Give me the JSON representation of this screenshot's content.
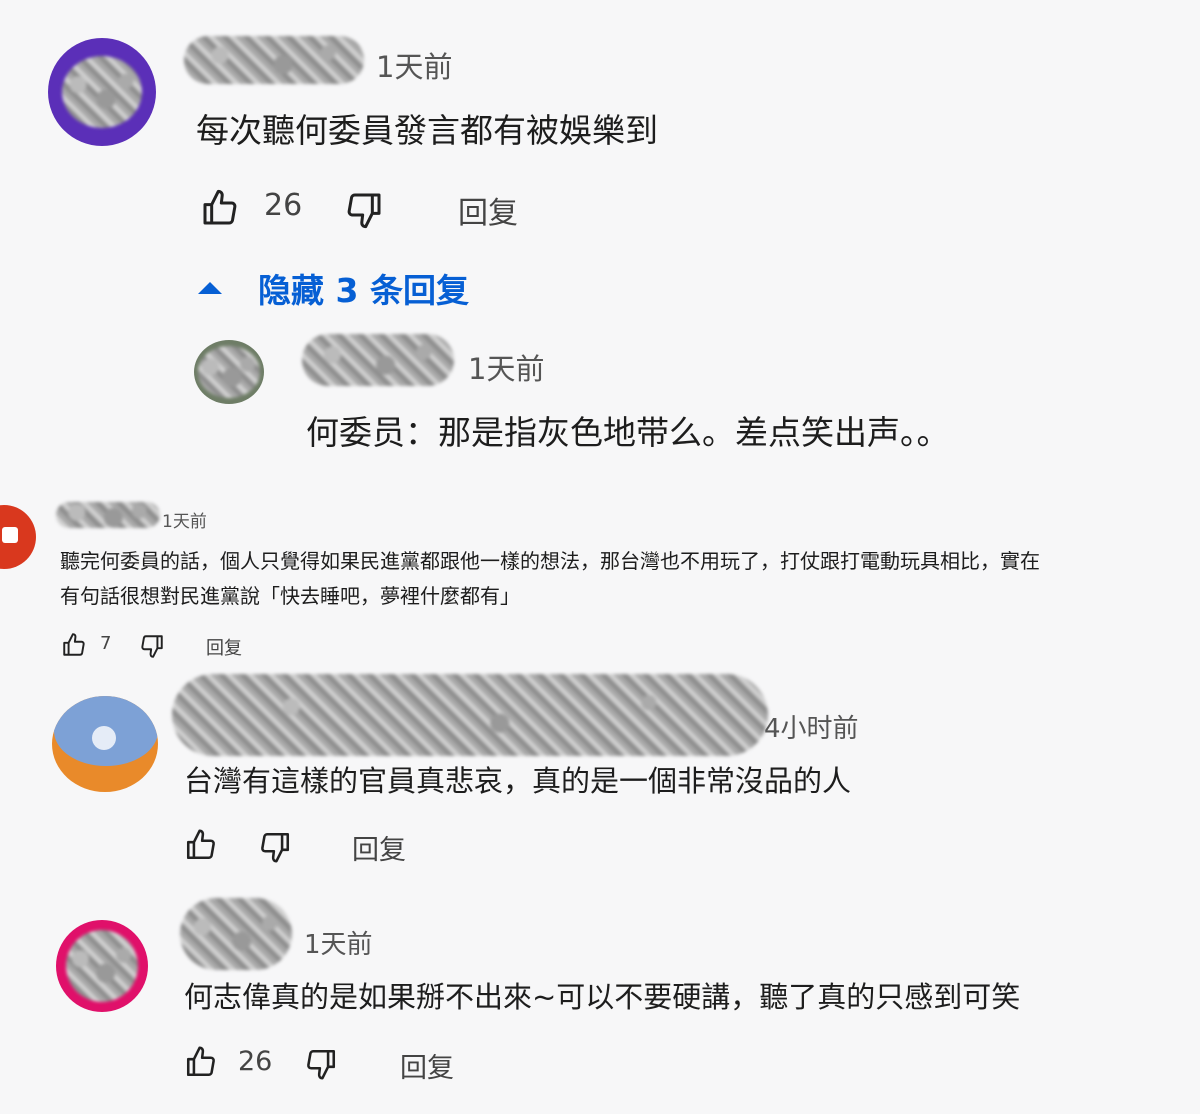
{
  "comments": [
    {
      "time": "1天前",
      "text": "每次聽何委員發言都有被娛樂到",
      "likes": "26",
      "reply_label": "回复",
      "toggle_replies_label": "隐藏 3 条回复"
    },
    {
      "time": "1天前",
      "text": "何委员：那是指灰色地带么。差点笑出声。。"
    },
    {
      "time": "1天前",
      "text_line1": "聽完何委員的話，個人只覺得如果民進黨都跟他一樣的想法，那台灣也不用玩了，打仗跟打電動玩具相比，實在",
      "text_line2": "有句話很想對民進黨說「快去睡吧，夢裡什麼都有」",
      "likes": "7",
      "reply_label": "回复"
    },
    {
      "time": "4小时前",
      "text": "台灣有這樣的官員真悲哀，真的是一個非常沒品的人",
      "reply_label": "回复"
    },
    {
      "time": "1天前",
      "text": "何志偉真的是如果掰不出來~可以不要硬講，聽了真的只感到可笑",
      "likes": "26",
      "reply_label": "回复"
    }
  ],
  "colors": {
    "accent": "#065fd4",
    "avatar1_ring": "#5b2fb8",
    "avatar5_ring": "#e0106a"
  },
  "icons": [
    "thumbs-up-icon",
    "thumbs-down-icon",
    "chevron-up-icon"
  ]
}
